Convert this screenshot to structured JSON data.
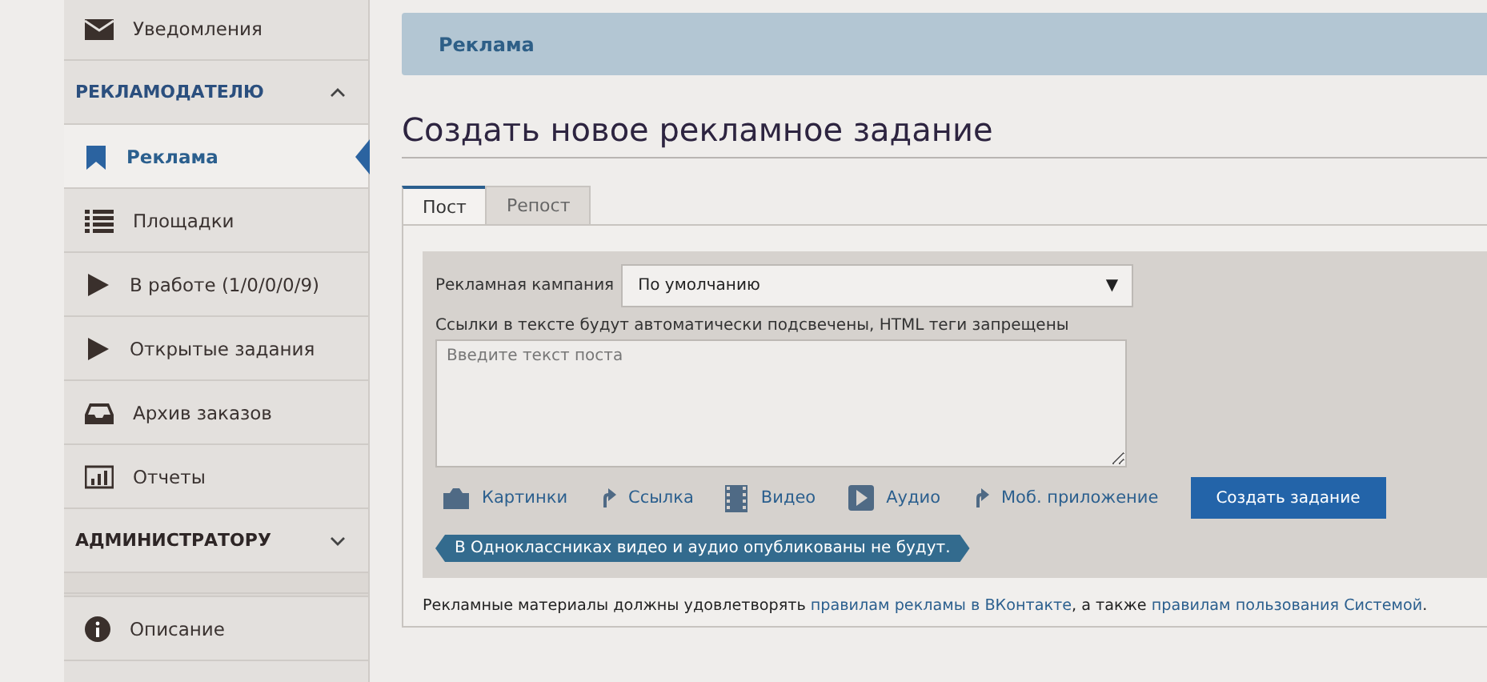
{
  "sidebar": {
    "items": [
      {
        "kind": "item",
        "label": "Уведомления",
        "selected": false
      },
      {
        "kind": "section",
        "label": "РЕКЛАМОДАТЕЛЮ",
        "expanded": true
      },
      {
        "kind": "item",
        "label": "Реклама",
        "selected": true
      },
      {
        "kind": "item",
        "label": "Площадки",
        "selected": false
      },
      {
        "kind": "item",
        "label": "В работе (1/0/0/0/9)",
        "selected": false
      },
      {
        "kind": "item",
        "label": "Открытые задания",
        "selected": false
      },
      {
        "kind": "item",
        "label": "Архив заказов",
        "selected": false
      },
      {
        "kind": "item",
        "label": "Отчеты",
        "selected": false
      },
      {
        "kind": "section",
        "label": "АДМИНИСТРАТОРУ",
        "expanded": false
      },
      {
        "kind": "spacer"
      },
      {
        "kind": "item",
        "label": "Описание",
        "selected": false
      }
    ]
  },
  "breadcrumb": "Реклама",
  "title": "Создать новое рекламное задание",
  "tabs": [
    {
      "label": "Пост",
      "selected": true
    },
    {
      "label": "Репост",
      "selected": false
    }
  ],
  "form": {
    "campaign_label": "Рекламная кампания",
    "campaign_value": "По умолчанию",
    "dropdown_arrow": "▼",
    "hint": "Ссылки в тексте будут автоматически подсвечены, HTML теги запрещены",
    "placeholder": "Введите текст поста",
    "attachments": [
      "Картинки",
      "Ссылка",
      "Видео",
      "Аудио",
      "Моб. приложение"
    ],
    "submit": "Создать задание",
    "notice": "В Одноклассниках видео и аудио опубликованы не будут."
  },
  "footer": [
    {
      "text": "Рекламные материалы должны удовлетворять ",
      "link": false
    },
    {
      "text": "правилам рекламы в ВКонтакте",
      "link": true
    },
    {
      "text": ", а также ",
      "link": false
    },
    {
      "text": "правилам пользования Системой",
      "link": true
    },
    {
      "text": ".",
      "link": false
    }
  ]
}
